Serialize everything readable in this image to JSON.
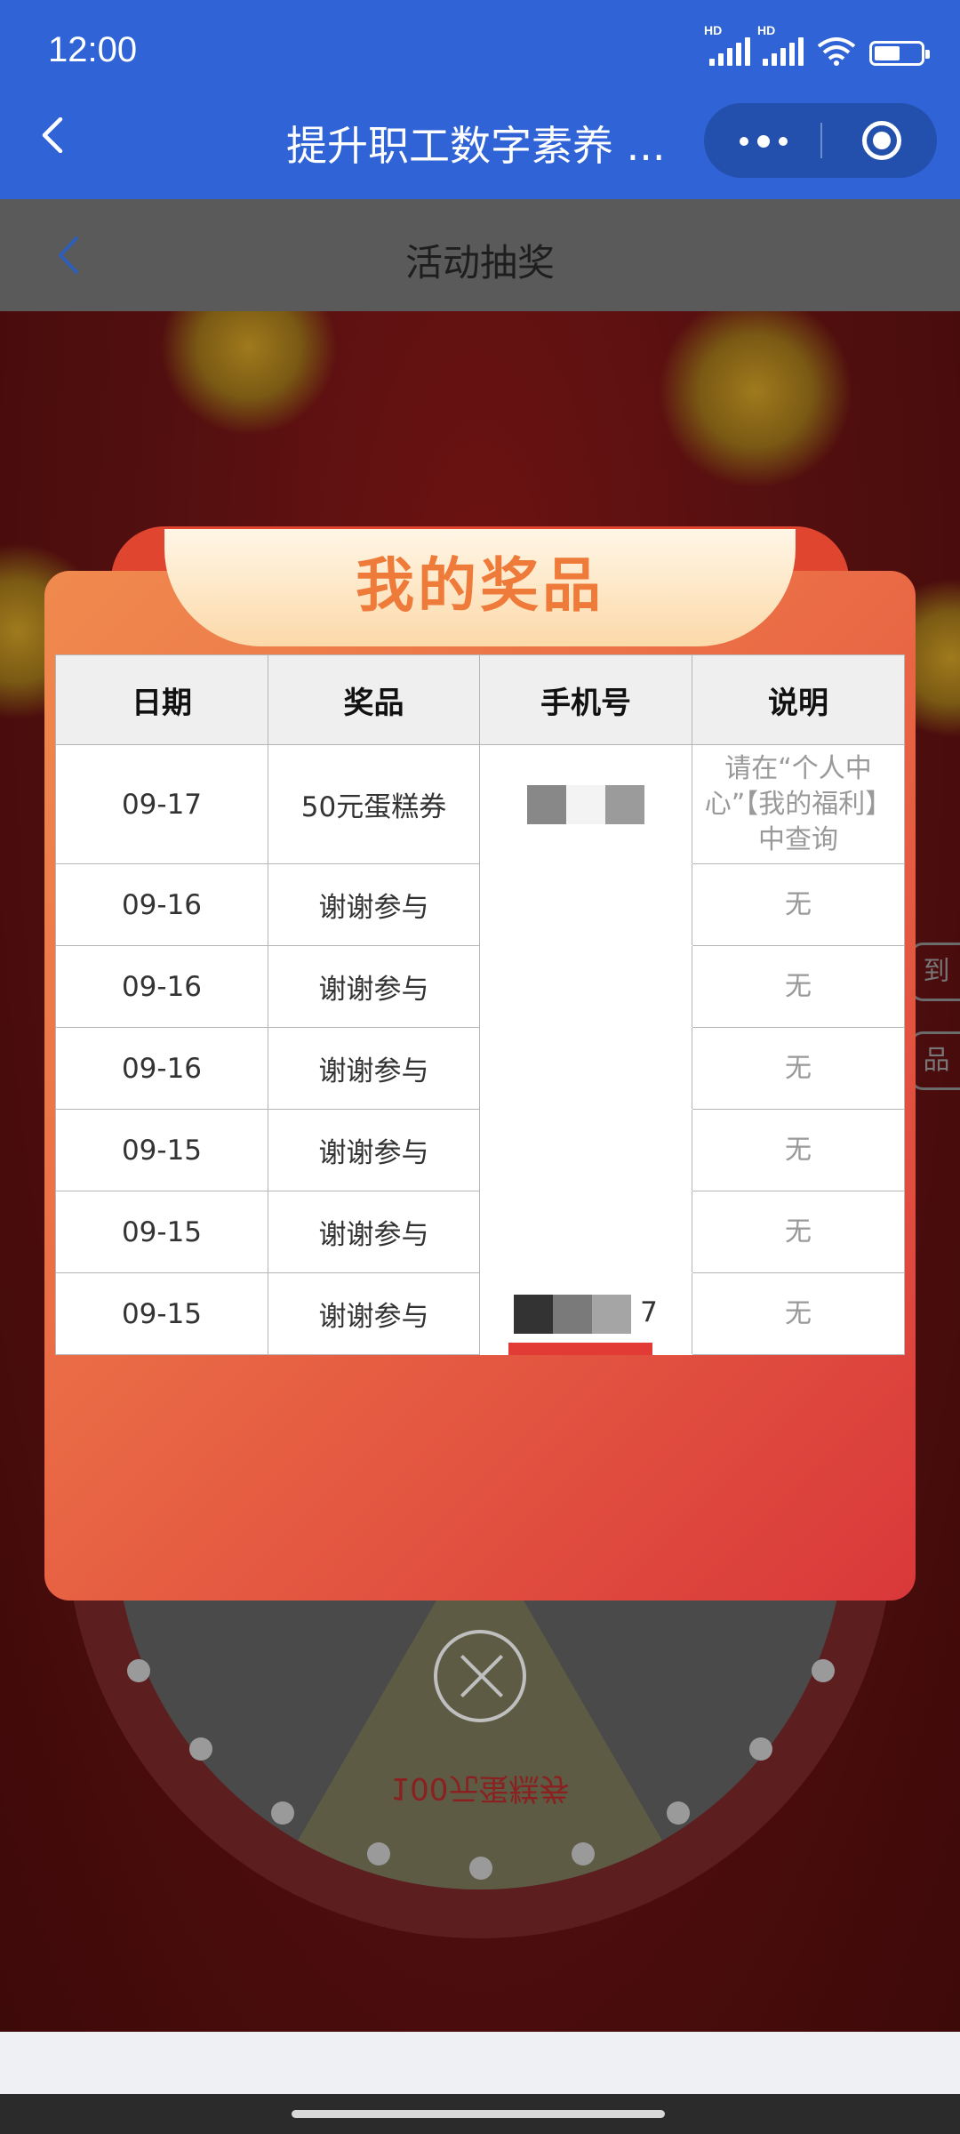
{
  "status_bar": {
    "time": "12:00",
    "signal_label_1": "HD",
    "signal_label_2": "HD"
  },
  "miniprogram": {
    "title": "提升职工数字素养 ..."
  },
  "page_header": {
    "title": "活动抽奖"
  },
  "background": {
    "wheel_prize_text": "100元蛋糕券",
    "side_btn_1": "到",
    "side_btn_2": "品"
  },
  "modal": {
    "title": "我的奖品",
    "columns": [
      "日期",
      "奖品",
      "手机号",
      "说明"
    ],
    "rows": [
      {
        "date": "09-17",
        "prize": "50元蛋糕券",
        "phone_tail": "",
        "note": "请在“个人中心”【我的福利】中查询"
      },
      {
        "date": "09-16",
        "prize": "谢谢参与",
        "phone_tail": "",
        "note": "无"
      },
      {
        "date": "09-16",
        "prize": "谢谢参与",
        "phone_tail": "",
        "note": "无"
      },
      {
        "date": "09-16",
        "prize": "谢谢参与",
        "phone_tail": "",
        "note": "无"
      },
      {
        "date": "09-15",
        "prize": "谢谢参与",
        "phone_tail": "",
        "note": "无"
      },
      {
        "date": "09-15",
        "prize": "谢谢参与",
        "phone_tail": "",
        "note": "无"
      },
      {
        "date": "09-15",
        "prize": "谢谢参与",
        "phone_tail": "7",
        "note": "无"
      }
    ]
  },
  "colors": {
    "blue_bar": "#2f63d6",
    "modal_orange": "#f08a4e",
    "modal_red": "#d9383a",
    "title_orange": "#ef7b3a"
  }
}
